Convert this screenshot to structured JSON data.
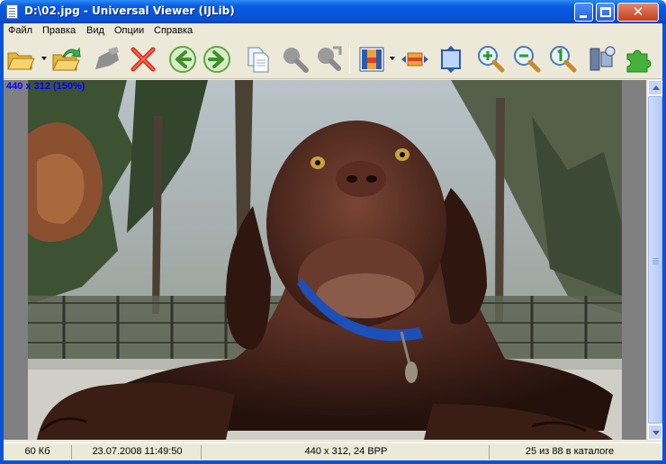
{
  "window": {
    "title": "D:\\02.jpg - Universal Viewer (IJLib)",
    "minimize_glyph": "_",
    "maximize_glyph": "□",
    "close_glyph": "✕"
  },
  "menu": {
    "items": [
      {
        "label": "Файл"
      },
      {
        "label": "Правка"
      },
      {
        "label": "Вид"
      },
      {
        "label": "Опции"
      },
      {
        "label": "Справка"
      }
    ]
  },
  "toolbar": {
    "buttons": [
      {
        "icon": "open-folder-icon",
        "enabled": true
      },
      {
        "icon": "reopen-folder-icon",
        "enabled": true
      },
      {
        "icon": "edit-icon",
        "enabled": false
      },
      {
        "icon": "delete-icon",
        "enabled": true
      },
      {
        "icon": "previous-icon",
        "enabled": true
      },
      {
        "icon": "next-icon",
        "enabled": true
      },
      {
        "icon": "copy-icon",
        "enabled": true
      },
      {
        "icon": "find-icon",
        "enabled": false
      },
      {
        "icon": "find-next-icon",
        "enabled": false
      },
      {
        "icon": "image-mode-icon",
        "enabled": true
      },
      {
        "icon": "fit-width-icon",
        "enabled": true
      },
      {
        "icon": "fit-window-icon",
        "enabled": true
      },
      {
        "icon": "zoom-in-icon",
        "enabled": true
      },
      {
        "icon": "zoom-out-icon",
        "enabled": true
      },
      {
        "icon": "zoom-original-icon",
        "enabled": true
      },
      {
        "icon": "options-icon",
        "enabled": true
      },
      {
        "icon": "plugins-icon",
        "enabled": true
      }
    ]
  },
  "viewer": {
    "info_overlay": "440 x 312 (150%)",
    "overlay_color": "#0000ff",
    "background_color": "#808080"
  },
  "status": {
    "file_size": "60 Кб",
    "date": "23.07.2008 11:49:50",
    "image_info": "440 x 312, 24 BPP",
    "position": "25 из 88 в каталоге"
  },
  "colors": {
    "titlebar": "#0a53d8",
    "chrome": "#ece9d8"
  }
}
